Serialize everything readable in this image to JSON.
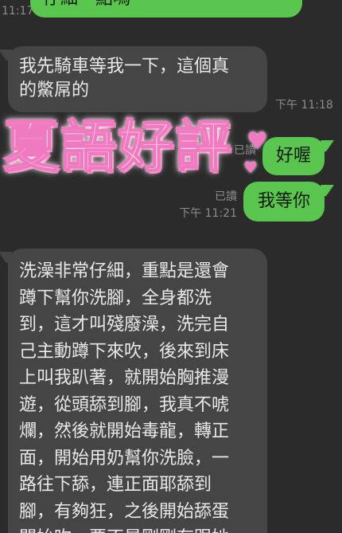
{
  "top_partial": {
    "time": "11:17",
    "bubble_text": "仔細一點嗎"
  },
  "messages": [
    {
      "id": "m1",
      "side": "in",
      "text_lines": [
        "我先騎車等我一下，這個真",
        "的鱉屌的"
      ],
      "time": "下午 11:18"
    },
    {
      "id": "m2",
      "side": "out",
      "text": "好喔",
      "read": "已讀"
    },
    {
      "id": "m3",
      "side": "out",
      "text": "我等你",
      "read": "已讀",
      "time": "下午 11:21"
    },
    {
      "id": "m4",
      "side": "in",
      "text_lines": [
        "洗澡非常仔細，重點是還會",
        "蹲下幫你洗腳，全身都洗",
        "到，這才叫殘廢澡，洗完自",
        "己主動蹲下來吹，後來到床",
        "上叫我趴著，就開始胸推漫",
        "遊，從頭舔到腳，我真不唬",
        "爛，然後就開始毒龍，轉正",
        "面，開始用奶幫你洗臉，一",
        "路往下舔，連正面耶舔到",
        "腳，有夠狂，之後開始舔蛋",
        "開始吹，要不是剛剛有跟她"
      ]
    }
  ],
  "overlay": {
    "title": "夏語好評",
    "heart_symbol": "♥"
  },
  "colors": {
    "background": "#2b2b2b",
    "incoming_bubble": "#454545",
    "outgoing_bubble": "#5ac54f",
    "meta_text": "#8c8c8c"
  }
}
